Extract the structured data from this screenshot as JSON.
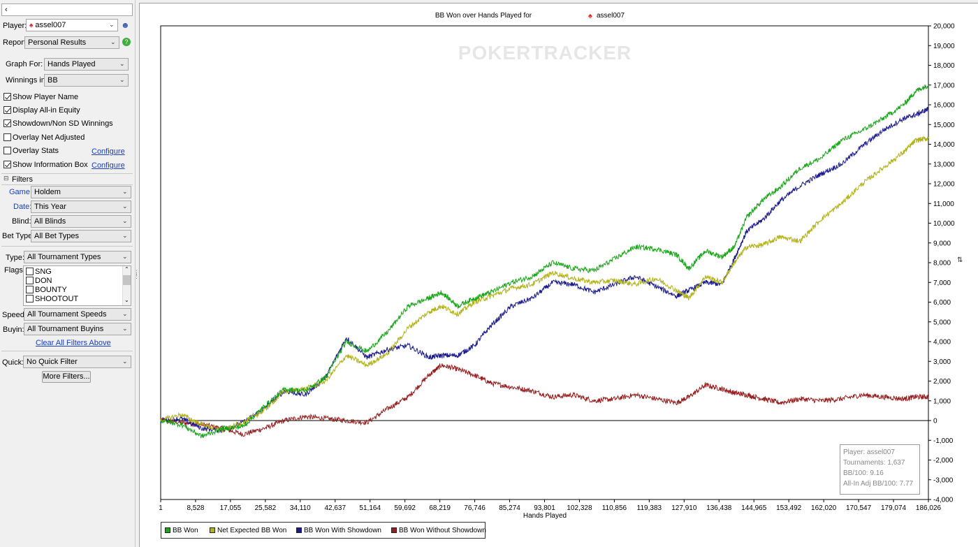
{
  "panel": {
    "top_field_value": "‹",
    "player_label": "Player:",
    "player_value": "assel007",
    "report_label": "Report:",
    "report_value": "Personal Results",
    "graph_for_label": "Graph For:",
    "graph_for_value": "Hands Played",
    "winnings_in_label": "Winnings in:",
    "winnings_in_value": "BB",
    "checkboxes": [
      {
        "label": "Show Player Name",
        "checked": true
      },
      {
        "label": "Display All-in Equity",
        "checked": true
      },
      {
        "label": "Showdown/Non SD Winnings",
        "checked": true
      },
      {
        "label": "Overlay Net Adjusted",
        "checked": false
      },
      {
        "label": "Overlay Stats",
        "checked": false
      },
      {
        "label": "Show Information Box",
        "checked": true
      }
    ],
    "configure_label": "Configure",
    "filters_header": "Filters",
    "game_label": "Game:",
    "game_value": "Holdem",
    "date_label": "Date:",
    "date_value": "This Year",
    "blind_label": "Blind:",
    "blind_value": "All Blinds",
    "bet_type_label": "Bet Type:",
    "bet_type_value": "All Bet Types",
    "type_label": "Type:",
    "type_value": "All Tournament Types",
    "flags_label": "Flags:",
    "flags": [
      "SNG",
      "DON",
      "BOUNTY",
      "SHOOTOUT"
    ],
    "speed_label": "Speed:",
    "speed_value": "All Tournament Speeds",
    "buyin_label": "Buyin:",
    "buyin_value": "All Tournament Buyins",
    "clear_filters": "Clear All Filters Above",
    "quick_label": "Quick:",
    "quick_value": "No Quick Filter",
    "more_filters": "More Filters..."
  },
  "chart_data": {
    "type": "line",
    "title": "BB Won over Hands Played for",
    "title_player": "assel007",
    "watermark": "POKERTRACKER",
    "xlabel": "Hands Played",
    "ylabel": "",
    "x_ticks": [
      "1",
      "8,528",
      "17,055",
      "25,582",
      "34,110",
      "42,637",
      "51,164",
      "59,692",
      "68,219",
      "76,746",
      "85,274",
      "93,801",
      "102,328",
      "110,856",
      "119,383",
      "127,910",
      "136,438",
      "144,965",
      "153,492",
      "162,020",
      "170,547",
      "179,074",
      "186,026"
    ],
    "xlim": [
      1,
      186026
    ],
    "ylim": [
      -4000,
      20000
    ],
    "y_ticks": [
      -4000,
      -3000,
      -2000,
      -1000,
      0,
      1000,
      2000,
      3000,
      4000,
      5000,
      6000,
      7000,
      8000,
      9000,
      10000,
      11000,
      12000,
      13000,
      14000,
      15000,
      16000,
      17000,
      18000,
      19000,
      20000
    ],
    "y_tick_labels": [
      "-4,000",
      "-3,000",
      "-2,000",
      "-1,000",
      "0",
      "1,000",
      "2,000",
      "3,000",
      "4,000",
      "5,000",
      "6,000",
      "7,000",
      "8,000",
      "9,000",
      "10,000",
      "11,000",
      "12,000",
      "13,000",
      "14,000",
      "15,000",
      "16,000",
      "17,000",
      "18,000",
      "19,000",
      "20,000"
    ],
    "grid": false,
    "legend_position": "bottom-left",
    "series": [
      {
        "name": "BB Won",
        "color": "#1aa51a",
        "x": [
          1,
          5000,
          10000,
          15000,
          20000,
          25000,
          30000,
          35000,
          40000,
          45000,
          50000,
          55000,
          60000,
          65000,
          68000,
          72000,
          76000,
          80000,
          85000,
          90000,
          95000,
          100000,
          105000,
          110000,
          115000,
          120000,
          125000,
          128000,
          132000,
          136000,
          139000,
          142000,
          146000,
          150000,
          155000,
          160000,
          165000,
          170000,
          175000,
          180000,
          183000,
          186026
        ],
        "y": [
          0,
          -200,
          -800,
          -400,
          -300,
          700,
          1600,
          1500,
          2200,
          4000,
          3500,
          4500,
          5800,
          6200,
          6500,
          5800,
          6200,
          6500,
          7000,
          7300,
          8000,
          7700,
          7600,
          8200,
          8800,
          8700,
          8400,
          7700,
          8600,
          8300,
          8800,
          10300,
          11200,
          11800,
          12800,
          13300,
          14200,
          14700,
          15300,
          16000,
          16700,
          17000
        ]
      },
      {
        "name": "Net Expected BB Won",
        "color": "#b2b21a",
        "x": [
          1,
          5000,
          10000,
          15000,
          20000,
          25000,
          30000,
          35000,
          40000,
          45000,
          50000,
          55000,
          60000,
          65000,
          68000,
          72000,
          76000,
          80000,
          85000,
          90000,
          95000,
          100000,
          105000,
          110000,
          115000,
          120000,
          125000,
          128000,
          132000,
          136000,
          139000,
          142000,
          146000,
          150000,
          155000,
          160000,
          165000,
          170000,
          175000,
          180000,
          183000,
          186026
        ],
        "y": [
          0,
          300,
          -200,
          -500,
          -100,
          500,
          1500,
          1600,
          2000,
          3300,
          2800,
          3400,
          4700,
          5500,
          5800,
          5400,
          6000,
          6300,
          6700,
          6900,
          7500,
          7200,
          7000,
          7100,
          6900,
          7200,
          6600,
          6200,
          7300,
          7000,
          8000,
          8800,
          8900,
          9300,
          9100,
          10200,
          11000,
          12000,
          12800,
          13600,
          14200,
          14300
        ]
      },
      {
        "name": "BB Won With Showdown",
        "color": "#1a1a8c",
        "x": [
          1,
          5000,
          10000,
          15000,
          20000,
          25000,
          30000,
          35000,
          40000,
          45000,
          50000,
          55000,
          60000,
          65000,
          68000,
          72000,
          76000,
          80000,
          85000,
          90000,
          95000,
          100000,
          105000,
          110000,
          115000,
          120000,
          125000,
          128000,
          132000,
          136000,
          139000,
          142000,
          146000,
          150000,
          155000,
          160000,
          165000,
          170000,
          175000,
          180000,
          183000,
          186026
        ],
        "y": [
          0,
          100,
          -400,
          -500,
          -100,
          600,
          1500,
          1300,
          2200,
          4200,
          3200,
          3600,
          3800,
          3200,
          3300,
          3300,
          3800,
          4800,
          5800,
          6200,
          7000,
          6900,
          6500,
          6900,
          7300,
          6800,
          6300,
          6600,
          7000,
          6900,
          8200,
          9600,
          10200,
          11100,
          11900,
          12500,
          13000,
          13900,
          14700,
          15300,
          15500,
          15800
        ]
      },
      {
        "name": "BB Won Without Showdown",
        "color": "#961e1e",
        "x": [
          1,
          5000,
          10000,
          15000,
          20000,
          25000,
          30000,
          35000,
          40000,
          45000,
          50000,
          55000,
          60000,
          65000,
          68000,
          72000,
          76000,
          80000,
          85000,
          90000,
          95000,
          100000,
          105000,
          110000,
          115000,
          120000,
          125000,
          128000,
          132000,
          136000,
          139000,
          142000,
          146000,
          150000,
          155000,
          160000,
          165000,
          170000,
          175000,
          180000,
          183000,
          186026
        ],
        "y": [
          0,
          -100,
          -200,
          -400,
          -700,
          -400,
          0,
          200,
          100,
          0,
          -100,
          600,
          1200,
          2300,
          2800,
          2600,
          2300,
          1900,
          1700,
          1500,
          1200,
          1300,
          1000,
          1100,
          1300,
          1100,
          900,
          1200,
          1800,
          1600,
          1400,
          1300,
          1100,
          900,
          1100,
          1000,
          1100,
          1300,
          1200,
          1100,
          1200,
          1200
        ]
      }
    ],
    "info_box": [
      "Player: assel007",
      "Tournaments: 1,637",
      "BB/100: 9.16",
      "All-In Adj BB/100: 7.77"
    ]
  }
}
